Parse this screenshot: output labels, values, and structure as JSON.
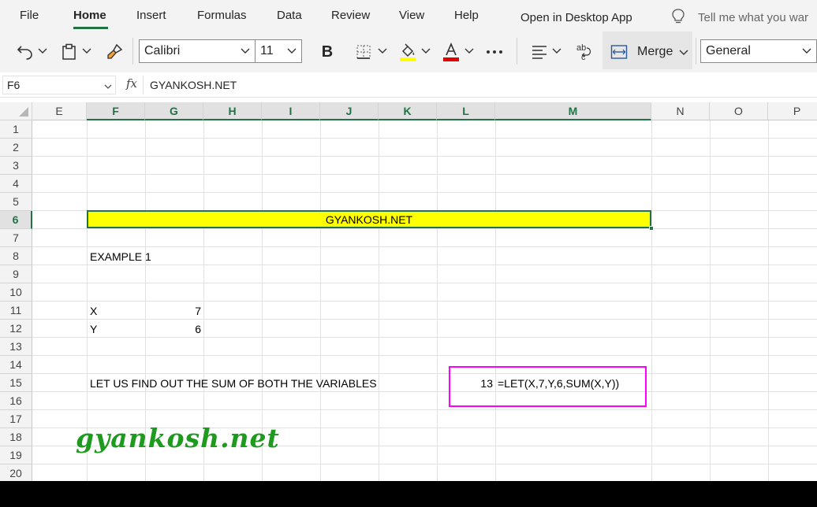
{
  "menu": {
    "tabs": [
      "File",
      "Home",
      "Insert",
      "Formulas",
      "Data",
      "Review",
      "View",
      "Help"
    ],
    "open_desktop": "Open in Desktop App",
    "tell_me": "Tell me what you war"
  },
  "ribbon": {
    "font_name": "Calibri",
    "font_size": "11",
    "bold_label": "B",
    "merge_label": "Merge",
    "number_format": "General",
    "highlight_color": "#ffff00",
    "font_color": "#e00000"
  },
  "formula_bar": {
    "name_box": "F6",
    "fx_label": "fx",
    "content": "GYANKOSH.NET"
  },
  "grid": {
    "columns": [
      "E",
      "F",
      "G",
      "H",
      "I",
      "J",
      "K",
      "L",
      "M",
      "N",
      "O",
      "P"
    ],
    "rows": [
      "1",
      "2",
      "3",
      "4",
      "5",
      "6",
      "7",
      "8",
      "9",
      "10",
      "11",
      "12",
      "13",
      "14",
      "15",
      "16",
      "17",
      "18",
      "19",
      "20"
    ],
    "selected_column": "F",
    "selected_row": "6"
  },
  "cells": {
    "merged_title": "GYANKOSH.NET",
    "example_label": "EXAMPLE 1",
    "x_label": "X",
    "x_value": "7",
    "y_label": "Y",
    "y_value": "6",
    "question": "LET US FIND OUT THE SUM OF BOTH THE VARIABLES",
    "result": "13",
    "formula_text": "=LET(X,7,Y,6,SUM(X,Y))"
  },
  "watermark": "gyankosh.net",
  "colors": {
    "accent": "#217346",
    "highlight_box": "#ff00ff",
    "watermark": "#1e9b1e"
  }
}
